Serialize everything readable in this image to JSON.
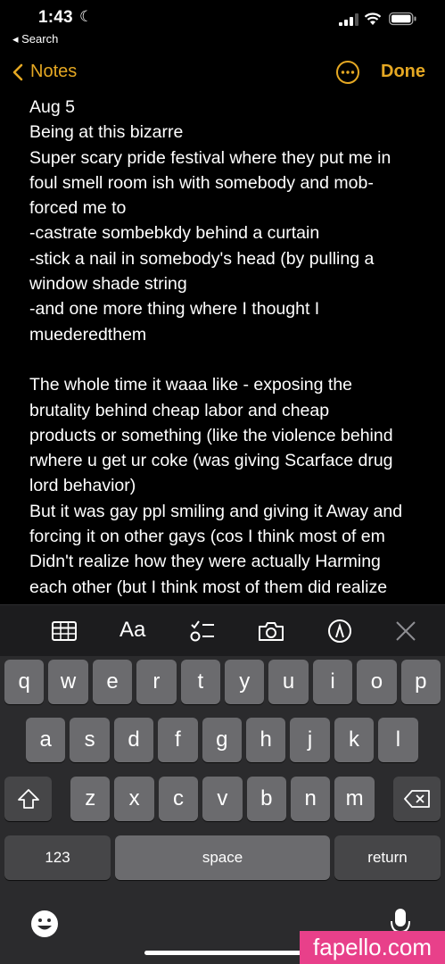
{
  "status_bar": {
    "time": "1:43",
    "back_app": "◂ Search"
  },
  "nav": {
    "back_label": "Notes",
    "done_label": "Done"
  },
  "note": {
    "lines": [
      "Aug 5",
      "Being at this bizarre",
      "Super scary pride festival where they put me in",
      "foul smell room ish with somebody and mob-",
      "forced me to",
      "-castrate sombebkdy behind a curtain",
      "-stick a nail in somebody's head (by pulling a",
      "window shade string",
      "-and one more thing where I thought I",
      "muederedthem",
      "",
      "The whole time it waaa like - exposing the",
      "brutality behind cheap labor and cheap",
      "products  or something (like the violence behind",
      "rwhere u get ur coke (was giving Scarface drug",
      "lord behavior)",
      "But it was gay ppl smiling and giving it Away and",
      "forcing it on other gays (cos I think most of em",
      "Didn't realize how they were actually Harming",
      "each other (but I think most of them did realize"
    ]
  },
  "toolbar": {
    "format_label": "Aa"
  },
  "keyboard": {
    "row1": [
      "q",
      "w",
      "e",
      "r",
      "t",
      "y",
      "u",
      "i",
      "o",
      "p"
    ],
    "row2": [
      "a",
      "s",
      "d",
      "f",
      "g",
      "h",
      "j",
      "k",
      "l"
    ],
    "row3": [
      "z",
      "x",
      "c",
      "v",
      "b",
      "n",
      "m"
    ],
    "numbers_label": "123",
    "space_label": "space",
    "return_label": "return"
  },
  "watermark": "fapello.com",
  "colors": {
    "accent": "#E5A823",
    "keyboard_bg": "#2b2b2d",
    "key": "#6b6b6e",
    "mod_key": "#464648"
  },
  "icons": [
    "moon-icon",
    "signal-icon",
    "wifi-icon",
    "battery-icon",
    "chevron-left-icon",
    "more-icon",
    "table-icon",
    "checklist-icon",
    "camera-icon",
    "markup-icon",
    "close-icon",
    "shift-icon",
    "delete-icon",
    "emoji-icon",
    "microphone-icon"
  ]
}
